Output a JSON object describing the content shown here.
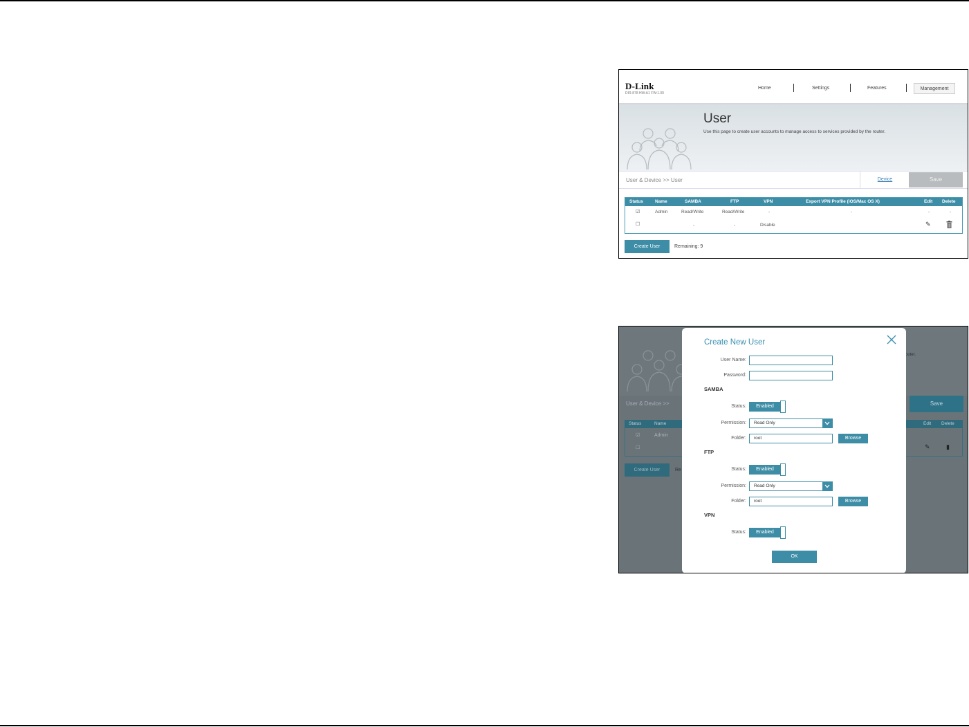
{
  "screen1": {
    "brand": {
      "logo": "D-Link",
      "model": "DIR-878 HW:A1 FW:1.00"
    },
    "nav": {
      "home": "Home",
      "settings": "Settings",
      "features": "Features",
      "management": "Management"
    },
    "page": {
      "title": "User",
      "description": "Use this page to create user accounts to manage access to services provided by the router.",
      "breadcrumb": "User & Device >> User",
      "device_link": "Device",
      "save_label": "Save"
    },
    "table": {
      "headers": [
        "Status",
        "Name",
        "SAMBA",
        "FTP",
        "VPN",
        "Export VPN Profile (iOS/Mac OS X)",
        "Edit",
        "Delete"
      ],
      "rows": [
        {
          "name": "Admin",
          "samba": "Read/Write",
          "ftp": "Read/Write",
          "vpn": "-",
          "export": "-",
          "edit": "-",
          "delete": "-"
        },
        {
          "name": "",
          "samba": "-",
          "ftp": "-",
          "vpn": "Disable",
          "export": "",
          "edit": "",
          "delete": ""
        }
      ]
    },
    "create_user_label": "Create User",
    "remaining": "Remaining: 9"
  },
  "screen2": {
    "background": {
      "breadcrumb": "User & Device >>",
      "save_label": "Save",
      "header_status": "Status",
      "header_name": "Name",
      "header_edit": "Edit",
      "header_delete": "Delete",
      "row_admin": "Admin",
      "create_user_label": "Create User",
      "remaining_fragment": "Re",
      "desc_fragment": "router."
    },
    "modal": {
      "title": "Create New User",
      "user_name_label": "User Name:",
      "password_label": "Password:",
      "samba": {
        "section": "SAMBA",
        "status_label": "Status:",
        "status_value": "Enabled",
        "permission_label": "Permission:",
        "permission_value": "Read Only",
        "folder_label": "Folder:",
        "folder_value": "root",
        "browse_label": "Browse"
      },
      "ftp": {
        "section": "FTP",
        "status_label": "Status:",
        "status_value": "Enabled",
        "permission_label": "Permission:",
        "permission_value": "Read Only",
        "folder_label": "Folder:",
        "folder_value": "root",
        "browse_label": "Browse"
      },
      "vpn": {
        "section": "VPN",
        "status_label": "Status:",
        "status_value": "Enabled"
      },
      "ok_label": "OK"
    }
  },
  "colors": {
    "accent": "#3d8da6",
    "link": "#3a7fb5",
    "title_blue": "#3a8fb0"
  }
}
